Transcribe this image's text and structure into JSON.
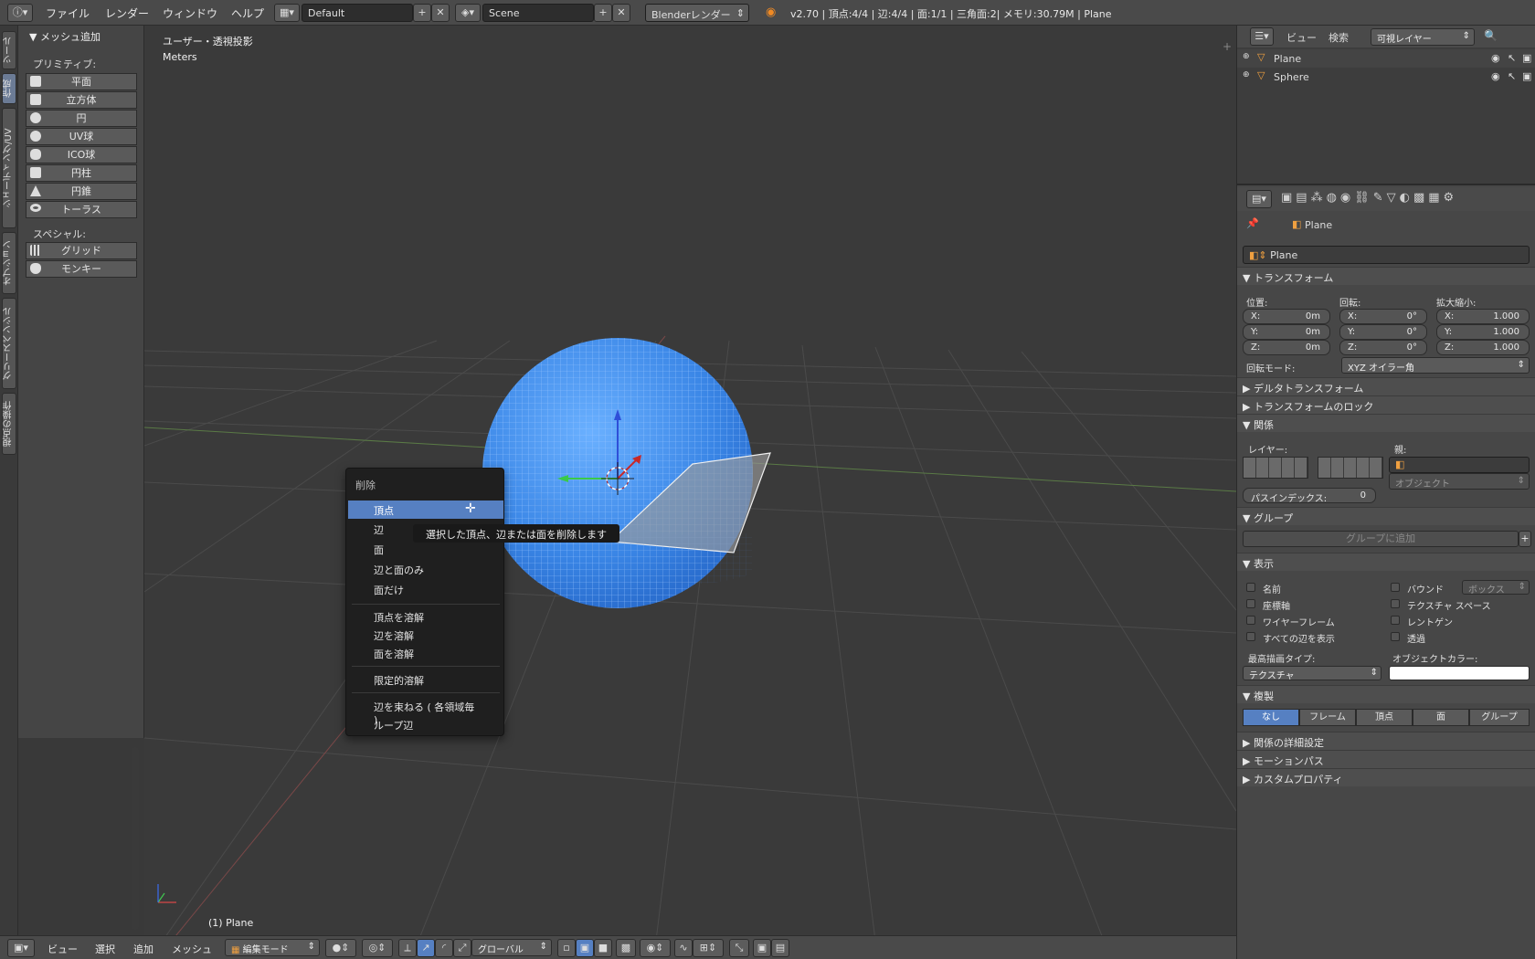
{
  "topbar": {
    "info_icon": "info-icon",
    "menus": [
      "ファイル",
      "レンダー",
      "ウィンドウ",
      "ヘルプ"
    ],
    "screen": "Default",
    "scene": "Scene",
    "engine": "Blenderレンダー",
    "stats": "v2.70 | 頂点:4/4 | 辺:4/4 | 面:1/1 | 三角面:2| メモリ:30.79M | Plane"
  },
  "left_tabs": [
    "ツール",
    "作成",
    "シェーディング/UV",
    "オプション",
    "グリースペンシル",
    "視点の操作"
  ],
  "tool_panel": {
    "header": "メッシュ追加",
    "primitives_label": "プリミティブ:",
    "primitives": [
      "平面",
      "立方体",
      "円",
      "UV球",
      "ICO球",
      "円柱",
      "円錐",
      "トーラス"
    ],
    "special_label": "スペシャル:",
    "special": [
      "グリッド",
      "モンキー"
    ]
  },
  "viewport": {
    "view_name": "ユーザー・透視投影",
    "units": "Meters",
    "object_label": "(1) Plane"
  },
  "context_menu": {
    "title": "削除",
    "items": [
      "頂点",
      "辺",
      "面",
      "辺と面のみ",
      "面だけ",
      "頂点を溶解",
      "辺を溶解",
      "面を溶解",
      "限定的溶解",
      "辺を束ねる ( 各領域毎 )",
      "ループ辺"
    ],
    "highlighted": "頂点",
    "tooltip": "選択した頂点、辺または面を削除します"
  },
  "outliner": {
    "menus": [
      "ビュー",
      "検索"
    ],
    "layer_filter": "可視レイヤー",
    "objects": [
      "Plane",
      "Sphere"
    ]
  },
  "properties": {
    "breadcrumb": "Plane",
    "object_name": "Plane",
    "transform": {
      "title": "トランスフォーム",
      "location_label": "位置:",
      "rotation_label": "回転:",
      "scale_label": "拡大縮小:",
      "location": {
        "x": "0m",
        "y": "0m",
        "z": "0m"
      },
      "rotation": {
        "x": "0°",
        "y": "0°",
        "z": "0°"
      },
      "scale": {
        "x": "1.000",
        "y": "1.000",
        "z": "1.000"
      },
      "axis_x": "X:",
      "axis_y": "Y:",
      "axis_z": "Z:",
      "rotation_mode_label": "回転モード:",
      "rotation_mode": "XYZ オイラー角"
    },
    "delta_transform": "デルタトランスフォーム",
    "transform_lock": "トランスフォームのロック",
    "relations": {
      "title": "関係",
      "layers_label": "レイヤー:",
      "parent_label": "親:",
      "parent_type": "オブジェクト",
      "pass_index_label": "パスインデックス:",
      "pass_index": "0"
    },
    "groups": {
      "title": "グループ",
      "add_button": "グループに追加"
    },
    "display": {
      "title": "表示",
      "checks_left": [
        "名前",
        "座標軸",
        "ワイヤーフレーム",
        "すべての辺を表示"
      ],
      "checks_right": [
        "バウンド",
        "テクスチャ スペース",
        "レントゲン",
        "透過"
      ],
      "bounds_type": "ボックス",
      "max_draw_type_label": "最高描画タイプ:",
      "max_draw_type": "テクスチャ",
      "object_color_label": "オブジェクトカラー:"
    },
    "duplication": {
      "title": "複製",
      "options": [
        "なし",
        "フレーム",
        "頂点",
        "面",
        "グループ"
      ],
      "selected": "なし"
    },
    "collapsed": [
      "関係の詳細設定",
      "モーションパス",
      "カスタムプロパティ"
    ]
  },
  "bottombar": {
    "menus": [
      "ビュー",
      "選択",
      "追加",
      "メッシュ"
    ],
    "mode": "編集モード",
    "orientation": "グローバル"
  },
  "colors": {
    "accent": "#5680c2",
    "sphere": "#3d8ef0",
    "viewport_bg": "#3a3a3a"
  }
}
